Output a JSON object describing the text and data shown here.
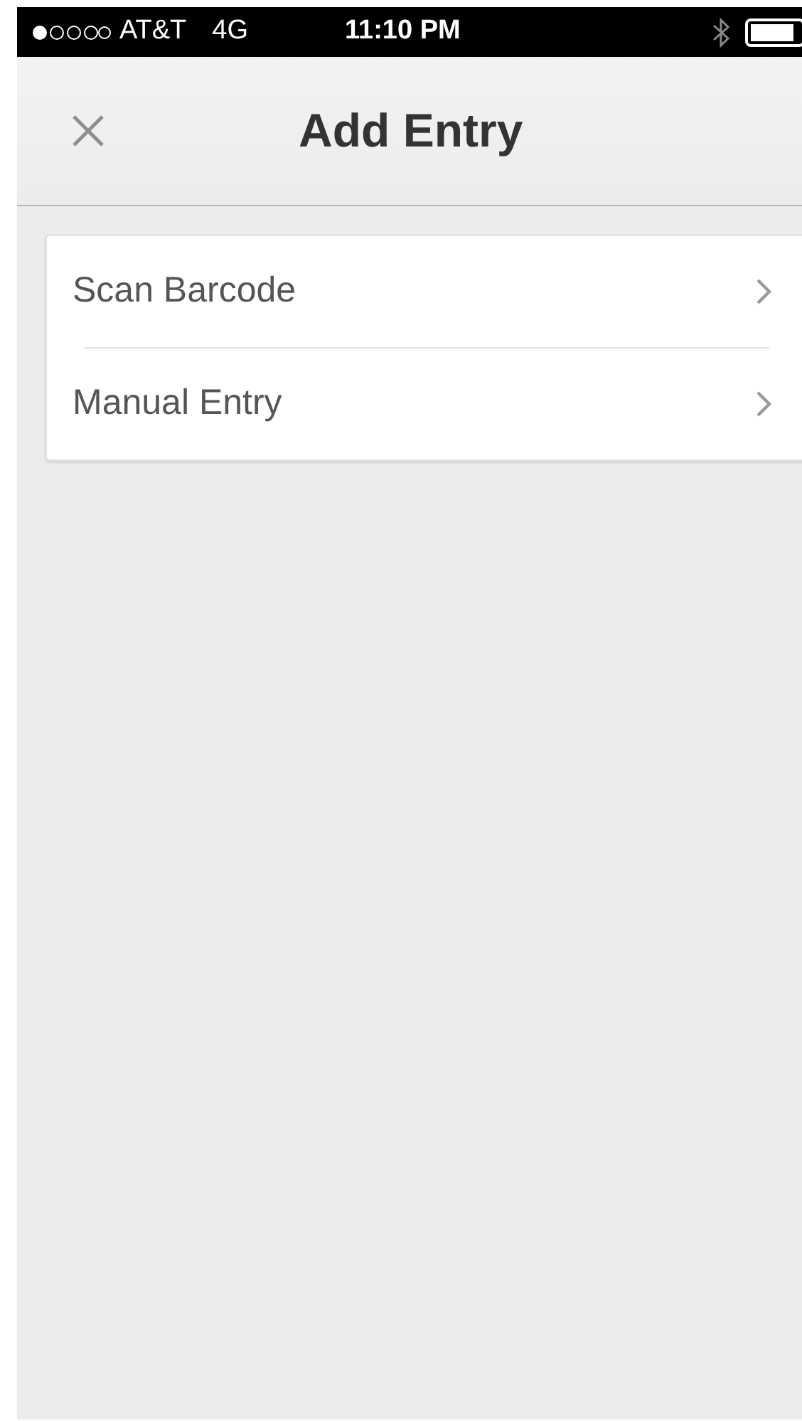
{
  "status_bar": {
    "carrier": "AT&T",
    "network": "4G",
    "time": "11:10 PM"
  },
  "nav_bar": {
    "title": "Add Entry"
  },
  "menu": [
    {
      "label": "Scan Barcode"
    },
    {
      "label": "Manual Entry"
    }
  ]
}
